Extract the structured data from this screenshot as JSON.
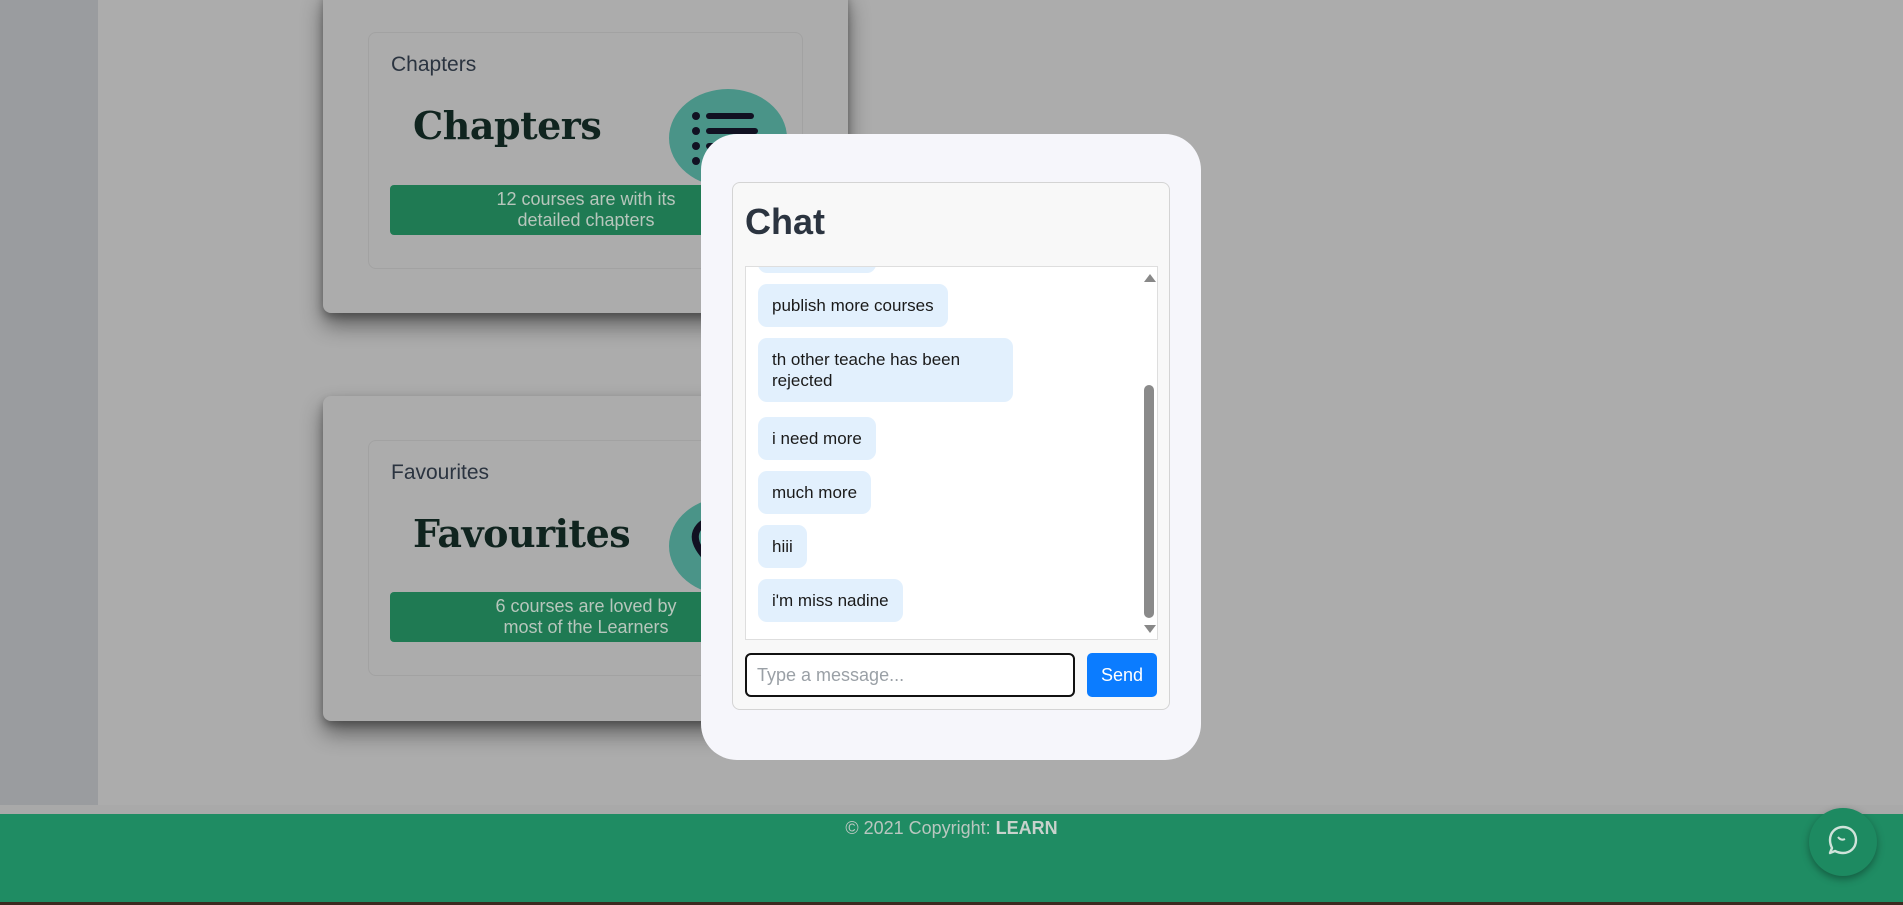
{
  "cards": [
    {
      "label": "Chapters",
      "big_title": "Chapters",
      "icon": "list-icon",
      "bar_text_line1": "12 courses are with its",
      "bar_text_line2": "detailed chapters"
    },
    {
      "label": "Favourites",
      "big_title": "Favourites",
      "icon": "heart-icon",
      "bar_text_line1": "6 courses are loved by",
      "bar_text_line2": "most of the Learners"
    }
  ],
  "chat": {
    "title": "Chat",
    "messages": [
      "publish more courses",
      "th other teache has been rejected",
      "i need more",
      "much more",
      "hiii",
      "i'm miss nadine"
    ],
    "input_placeholder": "Type a message...",
    "send_label": "Send"
  },
  "footer": {
    "copyright": "© 2021 Copyright: ",
    "brand": "LEARN"
  },
  "colors": {
    "footer_bg": "#1f8c63",
    "send_button": "#0b7cff",
    "message_bubble": "#e2f0fd",
    "card_bar": "#1f7a53"
  }
}
